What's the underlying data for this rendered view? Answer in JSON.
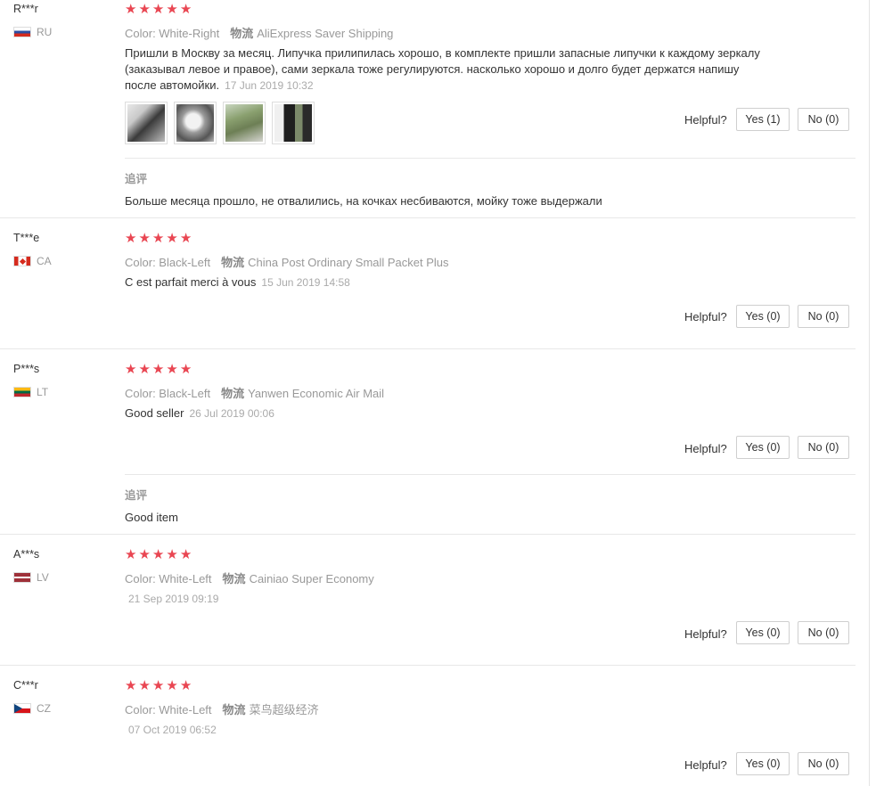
{
  "helpful_label": "Helpful?",
  "followup_label": "追评",
  "logistics_label": "物流",
  "colors": {
    "star": "#e94652",
    "meta": "#999999"
  },
  "reviews": [
    {
      "user": "R***r",
      "country": "RU",
      "flag": "ru-flag",
      "stars": 5,
      "color": "Color: White-Right",
      "logistics": "AliExpress Saver Shipping",
      "text": "Пришли в Москву за месяц. Липучка прилипилась хорошо, в комплекте пришли запасные липучки к каждому зеркалу (заказывал левое и правое), сами зеркала тоже регулируются. насколько хорошо и долго будет держатся напишу после автомойки.",
      "date": "17 Jun 2019 10:32",
      "photos": 4,
      "yes": "Yes (1)",
      "no": "No (0)",
      "followup": "Больше месяца прошло, не отвалились, на кочках несбиваются, мойку тоже выдержали"
    },
    {
      "user": "T***e",
      "country": "CA",
      "flag": "ca-flag",
      "stars": 5,
      "color": "Color: Black-Left",
      "logistics": "China Post Ordinary Small Packet Plus",
      "text": "C est parfait merci à vous",
      "date": "15 Jun 2019 14:58",
      "yes": "Yes (0)",
      "no": "No (0)"
    },
    {
      "user": "P***s",
      "country": "LT",
      "flag": "lt-flag",
      "stars": 5,
      "color": "Color: Black-Left",
      "logistics": "Yanwen Economic Air Mail",
      "text": "Good seller",
      "date": "26 Jul 2019 00:06",
      "yes": "Yes (0)",
      "no": "No (0)",
      "followup": "Good item"
    },
    {
      "user": "A***s",
      "country": "LV",
      "flag": "lv-flag",
      "stars": 5,
      "color": "Color: White-Left",
      "logistics": "Cainiao Super Economy",
      "date": "21 Sep 2019 09:19",
      "yes": "Yes (0)",
      "no": "No (0)"
    },
    {
      "user": "C***r",
      "country": "CZ",
      "flag": "cz-flag",
      "stars": 5,
      "color": "Color: White-Left",
      "logistics": "菜鸟超级经济",
      "date": "07 Oct 2019 06:52",
      "yes": "Yes (0)",
      "no": "No (0)"
    }
  ]
}
